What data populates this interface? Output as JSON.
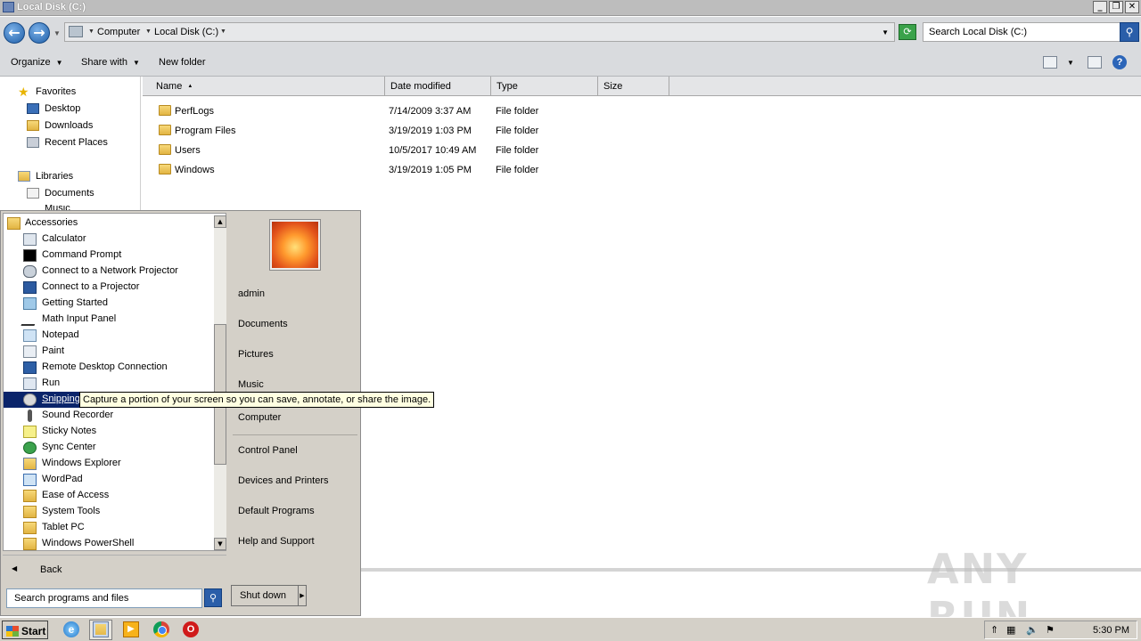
{
  "window": {
    "title": "Local Disk (C:)",
    "controls": [
      "_",
      "❐",
      "✕"
    ]
  },
  "address": {
    "crumbs": [
      "Computer",
      "Local Disk (C:)"
    ],
    "search_placeholder": "Search Local Disk (C:)"
  },
  "toolbar": {
    "organize": "Organize",
    "share_with": "Share with",
    "new_folder": "New folder"
  },
  "nav": {
    "favorites_label": "Favorites",
    "favorites": [
      "Desktop",
      "Downloads",
      "Recent Places"
    ],
    "libraries_label": "Libraries",
    "libraries": [
      "Documents",
      "Music"
    ]
  },
  "columns": {
    "name": "Name",
    "date": "Date modified",
    "type": "Type",
    "size": "Size"
  },
  "files": [
    {
      "name": "PerfLogs",
      "date": "7/14/2009 3:37 AM",
      "type": "File folder"
    },
    {
      "name": "Program Files",
      "date": "3/19/2019 1:03 PM",
      "type": "File folder"
    },
    {
      "name": "Users",
      "date": "10/5/2017 10:49 AM",
      "type": "File folder"
    },
    {
      "name": "Windows",
      "date": "3/19/2019 1:05 PM",
      "type": "File folder"
    }
  ],
  "start_menu": {
    "programs": [
      {
        "label": "Accessories",
        "icon": "folder-icon"
      },
      {
        "label": "Calculator",
        "icon": "calculator-icon"
      },
      {
        "label": "Command Prompt",
        "icon": "command-prompt-icon"
      },
      {
        "label": "Connect to a Network Projector",
        "icon": "network-projector-icon"
      },
      {
        "label": "Connect to a Projector",
        "icon": "projector-icon"
      },
      {
        "label": "Getting Started",
        "icon": "getting-started-icon"
      },
      {
        "label": "Math Input Panel",
        "icon": "math-input-icon"
      },
      {
        "label": "Notepad",
        "icon": "notepad-icon"
      },
      {
        "label": "Paint",
        "icon": "paint-icon"
      },
      {
        "label": "Remote Desktop Connection",
        "icon": "remote-desktop-icon"
      },
      {
        "label": "Run",
        "icon": "run-icon"
      },
      {
        "label": "Snipping Tool",
        "icon": "snipping-tool-icon"
      },
      {
        "label": "Sound Recorder",
        "icon": "microphone-icon"
      },
      {
        "label": "Sticky Notes",
        "icon": "sticky-notes-icon"
      },
      {
        "label": "Sync Center",
        "icon": "sync-icon"
      },
      {
        "label": "Windows Explorer",
        "icon": "explorer-icon"
      },
      {
        "label": "WordPad",
        "icon": "wordpad-icon"
      },
      {
        "label": "Ease of Access",
        "icon": "folder-icon"
      },
      {
        "label": "System Tools",
        "icon": "folder-icon"
      },
      {
        "label": "Tablet PC",
        "icon": "folder-icon"
      },
      {
        "label": "Windows PowerShell",
        "icon": "folder-icon"
      }
    ],
    "selected_visible_text": "Snipping",
    "back": "Back",
    "search_placeholder": "Search programs and files",
    "right_links": [
      "admin",
      "Documents",
      "Pictures",
      "Music",
      "Computer",
      "Control Panel",
      "Devices and Printers",
      "Default Programs",
      "Help and Support"
    ],
    "shutdown": "Shut down",
    "tooltip": "Capture a portion of your screen so you can save, annotate, or share the image."
  },
  "taskbar": {
    "start": "Start",
    "clock": "5:30 PM"
  },
  "watermark": "ANY RUN"
}
